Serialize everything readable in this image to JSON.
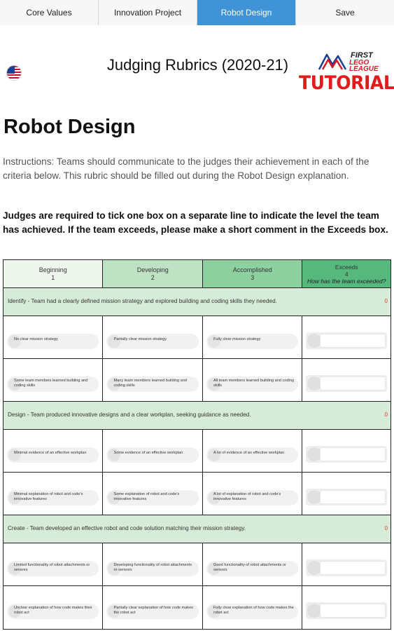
{
  "tabs": [
    {
      "label": "Core Values",
      "active": false
    },
    {
      "label": "Innovation Project",
      "active": false
    },
    {
      "label": "Robot Design",
      "active": true
    },
    {
      "label": "Save",
      "active": false
    }
  ],
  "header": {
    "title": "Judging Rubrics (2020-21)",
    "flag_icon": "us-flag-icon",
    "logo": {
      "first": "FIRST",
      "lego": "LEGO",
      "league": "LEAGUE",
      "tutorials": "TUTORIALS"
    }
  },
  "page": {
    "heading": "Robot Design",
    "instructions": "Instructions: Teams should communicate to the judges their achievement in each of the criteria below. This rubric should be filled out during the Robot Design explanation.",
    "judges_note": "Judges are required to tick one box on a separate line to indicate the level the team has achieved. If the team exceeds, please make a short comment in the Exceeds box."
  },
  "table": {
    "columns": [
      {
        "name": "Beginning",
        "level": "1"
      },
      {
        "name": "Developing",
        "level": "2"
      },
      {
        "name": "Accomplished",
        "level": "3"
      },
      {
        "name": "Exceeds",
        "level": "4",
        "sub": "How has the team exceeded?"
      }
    ],
    "sections": [
      {
        "title": "Identify - Team had a clearly defined mission strategy and explored building and coding skills they needed.",
        "score": "0",
        "rows": [
          [
            "No clear mission strategy",
            "Partially clear mission strategy",
            "Fully clear mission strategy"
          ],
          [
            "Some team members learned building and coding skills",
            "Many team members learned building and coding skills",
            "All team members learned building and coding skills"
          ]
        ]
      },
      {
        "title": "Design - Team produced innovative designs and a clear workplan, seeking guidance as needed.",
        "score": "0",
        "rows": [
          [
            "Minimal evidence of an effective workplan",
            "Some evidence of an effective workplan",
            "A lot of evidence of an effective workplan"
          ],
          [
            "Minimal explanation of robot and code's innovative features",
            "Some explanation of robot and code's innovative features",
            "A lot of explanation of robot and code's innovative features"
          ]
        ]
      },
      {
        "title": "Create - Team developed an effective robot and code solution matching their mission strategy.",
        "score": "0",
        "rows": [
          [
            "Limited functionality of robot attachments or sensors",
            "Developing functionality of robot attachments or sensors",
            "Good functionality of robot attachments or sensors"
          ],
          [
            "Unclear explanation of how code makes their robot act",
            "Partially clear explanation of how code makes the robot act",
            "Fully clear explanation of how code makes the robot act"
          ]
        ]
      }
    ]
  },
  "colors": {
    "tab_active": "#3f93d6",
    "beginning": "#eef6ee",
    "developing": "#bfe2c4",
    "accomplished": "#8fd0a0",
    "exceeds": "#56b87c",
    "section_bg": "#d7ecd8",
    "score": "#e53935",
    "logo_red": "#e11b1b"
  }
}
